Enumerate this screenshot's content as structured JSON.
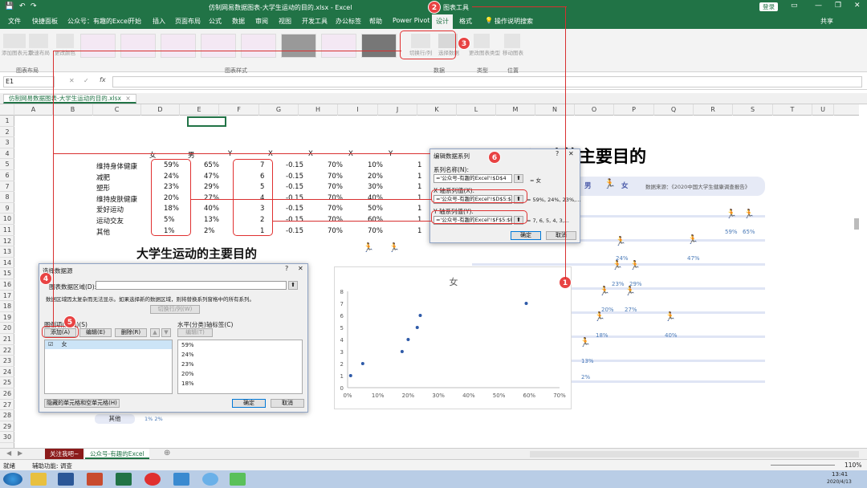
{
  "title_bar": {
    "title": "仿制网易数据图表-大学生运动的目的.xlsx - Excel",
    "chart_tools": "图表工具",
    "login": "登录"
  },
  "tabs": [
    "文件",
    "快捷面板",
    "公众号：有趣的Excel",
    "开始",
    "插入",
    "页面布局",
    "公式",
    "数据",
    "审阅",
    "视图",
    "开发工具",
    "办公标签",
    "帮助",
    "Power Pivot",
    "设计",
    "格式",
    "操作说明搜索"
  ],
  "share": "共享",
  "ribbon": {
    "groups": [
      "图表布局",
      "图表样式",
      "数据",
      "类型",
      "位置"
    ],
    "buttons": [
      "添加图表元素",
      "快速布局",
      "更改颜色",
      "切换行/列",
      "选择数据",
      "更改图表类型",
      "移动图表"
    ]
  },
  "formula_bar": {
    "name_box": "E1",
    "fx": "fx"
  },
  "workbook_tab": "仿制网易数据图表-大学生运动的目的.xlsx",
  "columns": [
    "A",
    "B",
    "C",
    "D",
    "E",
    "F",
    "G",
    "H",
    "I",
    "J",
    "K",
    "L",
    "M",
    "N",
    "O",
    "P",
    "Q",
    "R",
    "S",
    "T",
    "U"
  ],
  "rows": [
    "1",
    "2",
    "3",
    "4",
    "5",
    "6",
    "7",
    "8",
    "9",
    "10",
    "11",
    "12",
    "13",
    "14",
    "15",
    "16",
    "17",
    "18",
    "19",
    "20",
    "21",
    "22",
    "23",
    "24",
    "25",
    "26",
    "27",
    "28",
    "29",
    "30"
  ],
  "table": {
    "headers": [
      "女",
      "男",
      "Y",
      "X",
      "X",
      "X",
      "Y"
    ],
    "rows": [
      {
        "label": "维持身体健康",
        "d": "59%",
        "e": "65%",
        "f": "7",
        "g": "-0.15",
        "h": "70%",
        "i": "10%",
        "j": "1"
      },
      {
        "label": "减肥",
        "d": "24%",
        "e": "47%",
        "f": "6",
        "g": "-0.15",
        "h": "70%",
        "i": "20%",
        "j": "1"
      },
      {
        "label": "塑形",
        "d": "23%",
        "e": "29%",
        "f": "5",
        "g": "-0.15",
        "h": "70%",
        "i": "30%",
        "j": "1"
      },
      {
        "label": "维持皮肤健康",
        "d": "20%",
        "e": "27%",
        "f": "4",
        "g": "-0.15",
        "h": "70%",
        "i": "40%",
        "j": "1"
      },
      {
        "label": "爱好运动",
        "d": "18%",
        "e": "40%",
        "f": "3",
        "g": "-0.15",
        "h": "70%",
        "i": "50%",
        "j": "1"
      },
      {
        "label": "运动交友",
        "d": "5%",
        "e": "13%",
        "f": "2",
        "g": "-0.15",
        "h": "70%",
        "i": "60%",
        "j": "1"
      },
      {
        "label": "其他",
        "d": "1%",
        "e": "2%",
        "f": "1",
        "g": "-0.15",
        "h": "70%",
        "i": "70%",
        "j": "1"
      }
    ]
  },
  "sheet_title": "大学生运动的主要目的",
  "right_title": "运动的主要目的",
  "legend_right": {
    "male": "男",
    "female": "女",
    "source": "数据来源：《2020中国大学生健康调查报告》"
  },
  "right_pcts": [
    "59%",
    "65%",
    "47%",
    "24%",
    "23%",
    "29%",
    "20%",
    "27%",
    "18%",
    "40%",
    "13%",
    "2%"
  ],
  "edit_series": {
    "title": "编辑数据系列",
    "name_label": "系列名称(N):",
    "name_value": "='公众号-有趣的Excel'!$D$4",
    "name_result": "= 女",
    "x_label": "X 轴系列值(X):",
    "x_value": "='公众号-有趣的Excel'!$D$5:$D",
    "x_result": "= 59%, 24%, 23%,...",
    "y_label": "Y 轴系列值(Y):",
    "y_value": "='公众号-有趣的Excel'!$F$5:$F",
    "y_result": "= 7, 6, 5, 4, 3,...",
    "ok": "确定",
    "cancel": "取消"
  },
  "select_source": {
    "title": "选择数据源",
    "range_label": "图表数据区域(D):",
    "hint": "数据区域因太复杂而无法显示。如果选择新的数据区域，则将替换系列窗格中的所有系列。",
    "switch": "切换行/列(W)",
    "legend_label": "图例项(系列)(S)",
    "add": "添加(A)",
    "edit": "编辑(E)",
    "delete": "删除(R)",
    "axis_label": "水平(分类)轴标签(C)",
    "axis_edit": "编辑(T)",
    "series": [
      "女"
    ],
    "axis_values": [
      "59%",
      "24%",
      "23%",
      "20%",
      "18%"
    ],
    "hidden": "隐藏的单元格和空单元格(H)",
    "ok": "确定",
    "cancel": "取消"
  },
  "chart_data": {
    "type": "scatter",
    "title": "女",
    "x": [
      0.59,
      0.24,
      0.23,
      0.2,
      0.18,
      0.05,
      0.01
    ],
    "y": [
      7,
      6,
      5,
      4,
      3,
      2,
      1
    ],
    "xlim": [
      0,
      0.7
    ],
    "ylim": [
      0,
      8
    ],
    "xticks": [
      "0%",
      "10%",
      "20%",
      "30%",
      "40%",
      "50%",
      "60%",
      "70%"
    ],
    "yticks": [
      "0",
      "1",
      "2",
      "3",
      "4",
      "5",
      "6",
      "7",
      "8"
    ],
    "color": "#2e5aa8"
  },
  "bottom_row_label": "其他",
  "bottom_row_pct": "1% 2%",
  "sheet_tabs": [
    "关注我吧~",
    "公众号-有趣的Excel"
  ],
  "status": {
    "ready": "就绪",
    "accessibility": "辅助功能: 调查",
    "zoom": "110%"
  },
  "markers": [
    "1",
    "2",
    "3",
    "4",
    "5",
    "6"
  ],
  "clock": {
    "time": "13:41",
    "date": "2020/4/13"
  }
}
